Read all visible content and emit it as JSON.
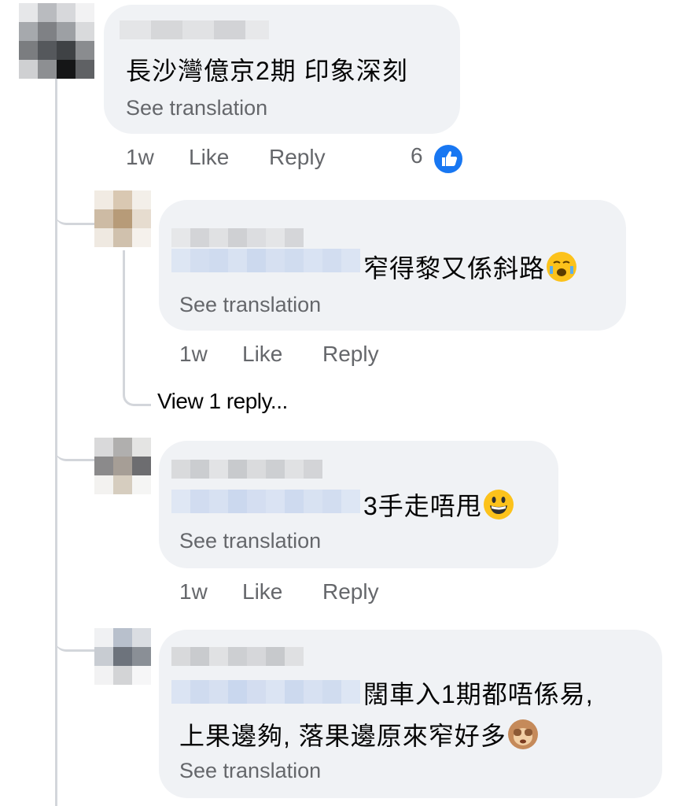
{
  "comments": [
    {
      "text": "長沙灣億京2期 印象深刻",
      "see_translation": "See translation",
      "time": "1w",
      "like": "Like",
      "reply": "Reply",
      "reaction_count": "6"
    },
    {
      "text": "窄得黎又係斜路",
      "emoji": "weary-face-emoji",
      "see_translation": "See translation",
      "time": "1w",
      "like": "Like",
      "reply": "Reply",
      "view_replies": "View 1 reply..."
    },
    {
      "text": "3手走唔甩",
      "emoji": "grinning-face-emoji",
      "see_translation": "See translation",
      "time": "1w",
      "like": "Like",
      "reply": "Reply"
    },
    {
      "text_line1": "闊車入1期都唔係易,",
      "text_line2": "上果邊夠, 落果邊原來窄好多",
      "emoji": "see-no-evil-emoji",
      "see_translation": "See translation"
    }
  ],
  "colors": {
    "bubble": "#f0f2f5",
    "meta": "#65676b",
    "like_blue": "#1877f2",
    "thread_line": "#d3d6db"
  }
}
